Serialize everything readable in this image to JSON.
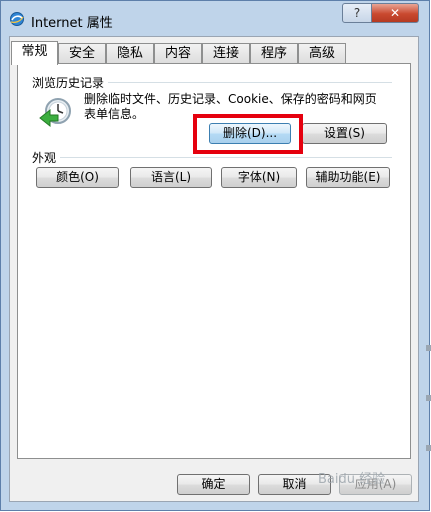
{
  "window": {
    "title": "Internet 属性",
    "help_label": "?",
    "close_label": "✕"
  },
  "tabs": [
    {
      "label": "常规",
      "active": true
    },
    {
      "label": "安全"
    },
    {
      "label": "隐私"
    },
    {
      "label": "内容"
    },
    {
      "label": "连接"
    },
    {
      "label": "程序"
    },
    {
      "label": "高级"
    }
  ],
  "browsing_history": {
    "group_label": "浏览历史记录",
    "description_line1": "删除临时文件、历史记录、Cookie、保存的密码和网页",
    "description_line2": "表单信息。",
    "delete_label": "删除(D)...",
    "settings_label": "设置(S)"
  },
  "appearance": {
    "group_label": "外观",
    "colors_label": "颜色(O)",
    "languages_label": "语言(L)",
    "fonts_label": "字体(N)",
    "accessibility_label": "辅助功能(E)"
  },
  "footer": {
    "ok_label": "确定",
    "cancel_label": "取消",
    "apply_label": "应用(A)"
  },
  "watermark": "Baidu 经验",
  "colors": {
    "highlight": "#e5000e",
    "close_button": "#c9492f",
    "frame": "#bfd4ea"
  },
  "icons": {
    "title": "ie-globe-icon",
    "history": "history-clock-icon"
  }
}
